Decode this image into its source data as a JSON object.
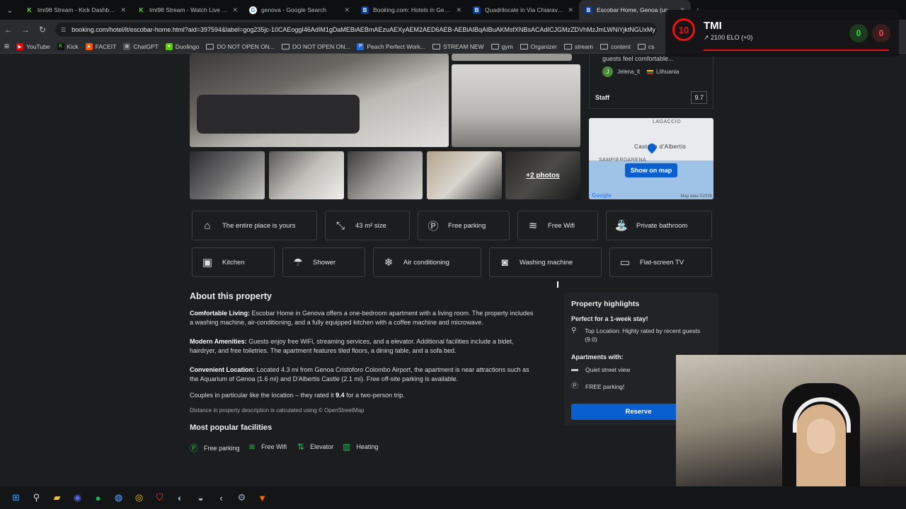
{
  "browser": {
    "tabs": [
      {
        "title": "tmi98 Stream - Kick Dashboard",
        "icon": "kick"
      },
      {
        "title": "tmi98 Stream - Watch Live on Kick",
        "icon": "kick"
      },
      {
        "title": "genova - Google Search",
        "icon": "google"
      },
      {
        "title": "Booking.com: Hotels in Genoa. Bo",
        "icon": "booking"
      },
      {
        "title": "Quadrilocale in Via Chiaravagna",
        "icon": "booking"
      },
      {
        "title": "Escobar Home, Genoa (update",
        "icon": "booking",
        "active": true
      }
    ],
    "url": "booking.com/hotel/it/escobar-home.html?aid=397594&label=gog235jc-10CAEoggI46AdIM1gDaMEBiAEBmAEzuAEXyAEM2AED6AEB-AEBiAIBqAIBuAKMsfXNBsACAdICJGMzZDVhMzJmLWNiYjktNGUxMy",
    "bookmarks": [
      "YouTube",
      "Kick",
      "FACEIT",
      "ChatGPT",
      "Duolingo",
      "DO NOT OPEN ON...",
      "DO NOT OPEN ON...",
      "Peach Perfect Work...",
      "STREAM NEW",
      "gym",
      "Organizer",
      "stream",
      "content",
      "cs"
    ]
  },
  "gallery": {
    "more_photos": "+2 photos"
  },
  "review": {
    "text": "guests feel comfortable...",
    "user_initial": "J",
    "user": "Jelena_lt",
    "country": "Lithuania"
  },
  "staff": {
    "label": "Staff",
    "score": "9.7"
  },
  "map": {
    "button": "Show on map",
    "labels": [
      "LAGACCIO",
      "Castello d'Albertis",
      "SAMPIERDARENA"
    ],
    "attribution": "Map data ©2026",
    "brand": "Google"
  },
  "facilities_row1": [
    {
      "label": "The entire place is yours",
      "icon": "house-icon"
    },
    {
      "label": "43 m² size",
      "icon": "size-icon"
    },
    {
      "label": "Free parking",
      "icon": "parking-icon"
    },
    {
      "label": "Free Wifi",
      "icon": "wifi-icon"
    },
    {
      "label": "Private bathroom",
      "icon": "bathroom-icon"
    }
  ],
  "facilities_row2": [
    {
      "label": "Kitchen",
      "icon": "kitchen-icon"
    },
    {
      "label": "Shower",
      "icon": "shower-icon"
    },
    {
      "label": "Air conditioning",
      "icon": "snowflake-icon"
    },
    {
      "label": "Washing machine",
      "icon": "washing-machine-icon"
    },
    {
      "label": "Flat-screen TV",
      "icon": "tv-icon"
    }
  ],
  "about": {
    "title": "About this property",
    "p1_bold": "Comfortable Living:",
    "p1": " Escobar Home in Genova offers a one-bedroom apartment with a living room. The property includes a washing machine, air-conditioning, and a fully equipped kitchen with a coffee machine and microwave.",
    "p2_bold": "Modern Amenities:",
    "p2": " Guests enjoy free WiFi, streaming services, and a elevator. Additional facilities include a bidet, hairdryer, and free toiletries. The apartment features tiled floors, a dining table, and a sofa bed.",
    "p3_bold": "Convenient Location:",
    "p3": " Located 4.3 mi from Genoa Cristoforo Colombo Airport, the apartment is near attractions such as the Aquarium of Genoa (1.6 mi) and D'Albertis Castle (2.1 mi). Free off-site parking is available.",
    "p4_pre": "Couples in particular like the location – they rated it ",
    "p4_score": "9.4",
    "p4_post": " for a two-person trip.",
    "distance_note": "Distance in property description is calculated using © OpenStreetMap"
  },
  "popular": {
    "title": "Most popular facilities",
    "items": [
      "Free parking",
      "Free Wifi",
      "Elevator",
      "Heating"
    ]
  },
  "highlights": {
    "title": "Property highlights",
    "stay": "Perfect for a 1-week stay!",
    "location": "Top Location: Highly rated by recent guests (9.0)",
    "apartments_with": "Apartments with:",
    "view": "Quiet street view",
    "parking": "FREE parking!",
    "reserve": "Reserve"
  },
  "overlay": {
    "level": "10",
    "name": "TMI",
    "elo": "2100 ELO (+0)",
    "wins": "0",
    "losses": "0"
  }
}
